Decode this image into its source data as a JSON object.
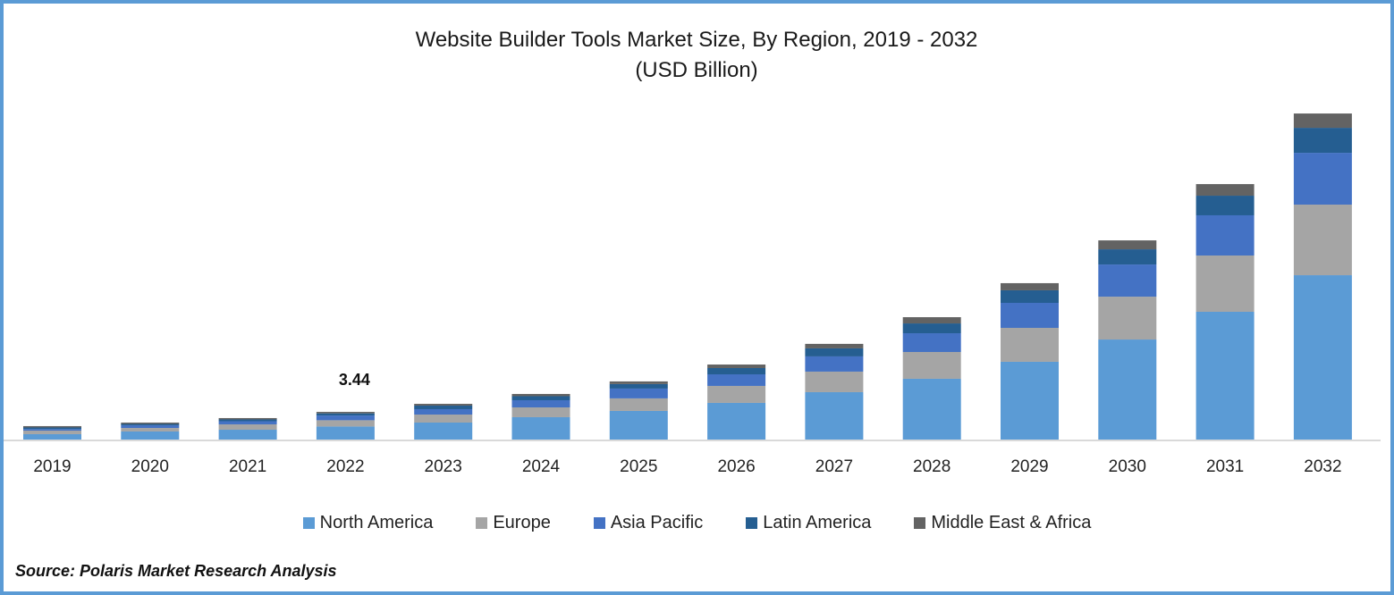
{
  "chart_data": {
    "type": "bar",
    "stacked": true,
    "title": "Website Builder Tools Market Size, By Region, 2019 - 2032",
    "subtitle": "(USD Billion)",
    "xlabel": "",
    "ylabel": "",
    "ylim": [
      0,
      42
    ],
    "grid": false,
    "legend_position": "bottom",
    "categories": [
      "2019",
      "2020",
      "2021",
      "2022",
      "2023",
      "2024",
      "2025",
      "2026",
      "2027",
      "2028",
      "2029",
      "2030",
      "2031",
      "2032"
    ],
    "series": [
      {
        "name": "North America",
        "color": "#5b9bd5",
        "values": [
          0.67,
          1.0,
          1.22,
          1.62,
          2.11,
          2.78,
          3.56,
          4.56,
          5.89,
          7.56,
          9.67,
          12.44,
          15.89,
          20.44
        ]
      },
      {
        "name": "Europe",
        "color": "#a5a5a5",
        "values": [
          0.44,
          0.44,
          0.67,
          0.78,
          1.0,
          1.22,
          1.56,
          2.11,
          2.56,
          3.33,
          4.22,
          5.33,
          7.0,
          8.78
        ]
      },
      {
        "name": "Asia Pacific",
        "color": "#4472c4",
        "values": [
          0.19,
          0.33,
          0.39,
          0.59,
          0.67,
          0.89,
          1.22,
          1.44,
          1.89,
          2.33,
          3.11,
          4.0,
          5.0,
          6.44
        ]
      },
      {
        "name": "Latin America",
        "color": "#255e91",
        "values": [
          0.2,
          0.17,
          0.22,
          0.27,
          0.44,
          0.5,
          0.56,
          0.78,
          1.0,
          1.22,
          1.56,
          1.89,
          2.44,
          3.11
        ]
      },
      {
        "name": "Middle East & Africa",
        "color": "#636363",
        "values": [
          0.17,
          0.17,
          0.17,
          0.18,
          0.22,
          0.28,
          0.33,
          0.44,
          0.56,
          0.78,
          0.89,
          1.11,
          1.44,
          1.78
        ]
      }
    ],
    "annotations": [
      {
        "category": "2022",
        "text": "3.44"
      }
    ]
  },
  "source": "Source: Polaris Market Research Analysis",
  "colors": {
    "border": "#5b9bd5",
    "axis": "#d9d9d9"
  }
}
